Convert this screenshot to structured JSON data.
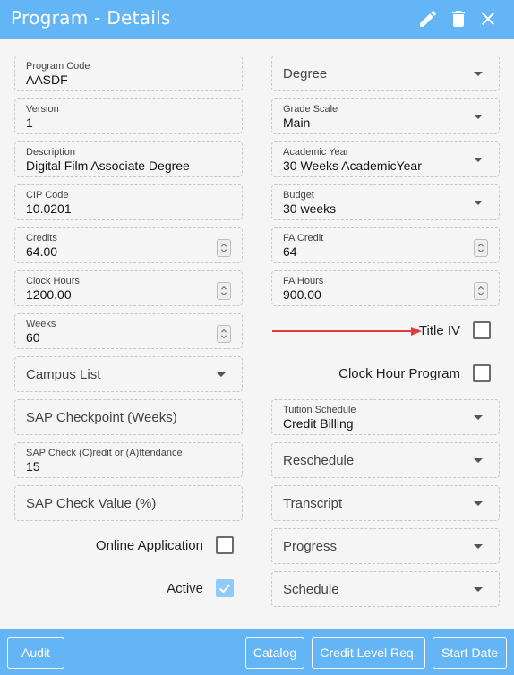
{
  "header": {
    "title": "Program - Details"
  },
  "left": {
    "program_code": {
      "label": "Program Code",
      "value": "AASDF"
    },
    "version": {
      "label": "Version",
      "value": "1"
    },
    "description": {
      "label": "Description",
      "value": "Digital Film Associate Degree"
    },
    "cip_code": {
      "label": "CIP Code",
      "value": "10.0201"
    },
    "credits": {
      "label": "Credits",
      "value": "64.00"
    },
    "clock_hours": {
      "label": "Clock Hours",
      "value": "1200.00"
    },
    "weeks": {
      "label": "Weeks",
      "value": "60"
    },
    "campus_list": {
      "placeholder": "Campus List"
    },
    "sap_checkpoint": {
      "placeholder": "SAP Checkpoint (Weeks)"
    },
    "sap_check_type": {
      "label": "SAP Check (C)redit or (A)ttendance",
      "value": "15"
    },
    "sap_check_value": {
      "placeholder": "SAP Check Value (%)"
    },
    "online_application": {
      "label": "Online Application",
      "checked": false
    },
    "active": {
      "label": "Active",
      "checked": true
    }
  },
  "right": {
    "degree": {
      "placeholder": "Degree"
    },
    "grade_scale": {
      "label": "Grade Scale",
      "value": "Main"
    },
    "academic_year": {
      "label": "Academic Year",
      "value": "30 Weeks AcademicYear"
    },
    "budget": {
      "label": "Budget",
      "value": "30 weeks"
    },
    "fa_credit": {
      "label": "FA Credit",
      "value": "64"
    },
    "fa_hours": {
      "label": "FA Hours",
      "value": "900.00"
    },
    "title_iv": {
      "label": "Title IV",
      "checked": false
    },
    "clock_hour_program": {
      "label": "Clock Hour Program",
      "checked": false
    },
    "tuition_schedule": {
      "label": "Tuition Schedule",
      "value": "Credit Billing"
    },
    "reschedule": {
      "placeholder": "Reschedule"
    },
    "transcript": {
      "placeholder": "Transcript"
    },
    "progress": {
      "placeholder": "Progress"
    },
    "schedule": {
      "placeholder": "Schedule"
    }
  },
  "footer": {
    "audit": "Audit",
    "catalog": "Catalog",
    "credit_level": "Credit Level Req.",
    "start_date": "Start Date"
  },
  "colors": {
    "header_bg": "#64b5f6",
    "annotation_arrow": "#e53935",
    "checked_box": "#90caf9"
  },
  "icons": [
    "pencil-icon",
    "trash-icon",
    "close-icon",
    "chevron-down-icon",
    "spinner-icon",
    "check-icon"
  ]
}
